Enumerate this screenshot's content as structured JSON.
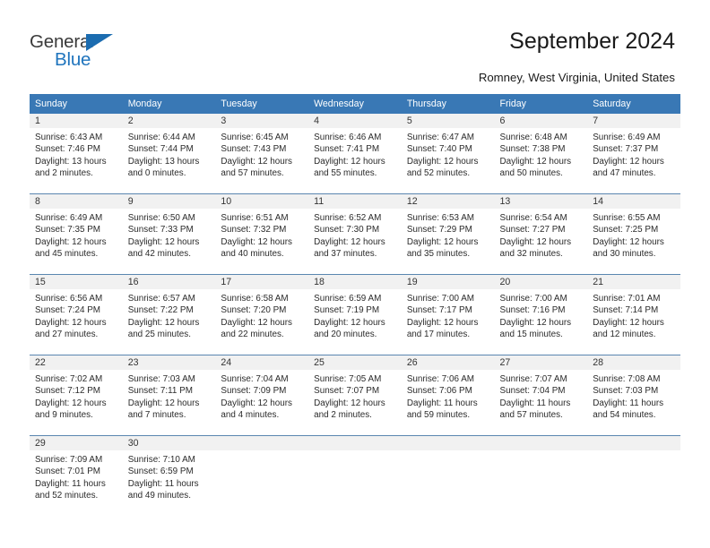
{
  "brand": {
    "name_top": "General",
    "name_bottom": "Blue",
    "accent_color": "#1f74bd",
    "triangle_color": "#1b6cb0"
  },
  "header": {
    "title": "September 2024",
    "subtitle": "Romney, West Virginia, United States"
  },
  "theme": {
    "header_row_bg": "#3978b5",
    "daynum_band_bg": "#f1f1f1",
    "week_separator": "#5a86b0",
    "text": "#2b2b2b"
  },
  "calendar": {
    "weekday_headers": [
      "Sunday",
      "Monday",
      "Tuesday",
      "Wednesday",
      "Thursday",
      "Friday",
      "Saturday"
    ],
    "weeks": [
      [
        {
          "day": "1",
          "sunrise": "Sunrise: 6:43 AM",
          "sunset": "Sunset: 7:46 PM",
          "daylight_1": "Daylight: 13 hours",
          "daylight_2": "and 2 minutes."
        },
        {
          "day": "2",
          "sunrise": "Sunrise: 6:44 AM",
          "sunset": "Sunset: 7:44 PM",
          "daylight_1": "Daylight: 13 hours",
          "daylight_2": "and 0 minutes."
        },
        {
          "day": "3",
          "sunrise": "Sunrise: 6:45 AM",
          "sunset": "Sunset: 7:43 PM",
          "daylight_1": "Daylight: 12 hours",
          "daylight_2": "and 57 minutes."
        },
        {
          "day": "4",
          "sunrise": "Sunrise: 6:46 AM",
          "sunset": "Sunset: 7:41 PM",
          "daylight_1": "Daylight: 12 hours",
          "daylight_2": "and 55 minutes."
        },
        {
          "day": "5",
          "sunrise": "Sunrise: 6:47 AM",
          "sunset": "Sunset: 7:40 PM",
          "daylight_1": "Daylight: 12 hours",
          "daylight_2": "and 52 minutes."
        },
        {
          "day": "6",
          "sunrise": "Sunrise: 6:48 AM",
          "sunset": "Sunset: 7:38 PM",
          "daylight_1": "Daylight: 12 hours",
          "daylight_2": "and 50 minutes."
        },
        {
          "day": "7",
          "sunrise": "Sunrise: 6:49 AM",
          "sunset": "Sunset: 7:37 PM",
          "daylight_1": "Daylight: 12 hours",
          "daylight_2": "and 47 minutes."
        }
      ],
      [
        {
          "day": "8",
          "sunrise": "Sunrise: 6:49 AM",
          "sunset": "Sunset: 7:35 PM",
          "daylight_1": "Daylight: 12 hours",
          "daylight_2": "and 45 minutes."
        },
        {
          "day": "9",
          "sunrise": "Sunrise: 6:50 AM",
          "sunset": "Sunset: 7:33 PM",
          "daylight_1": "Daylight: 12 hours",
          "daylight_2": "and 42 minutes."
        },
        {
          "day": "10",
          "sunrise": "Sunrise: 6:51 AM",
          "sunset": "Sunset: 7:32 PM",
          "daylight_1": "Daylight: 12 hours",
          "daylight_2": "and 40 minutes."
        },
        {
          "day": "11",
          "sunrise": "Sunrise: 6:52 AM",
          "sunset": "Sunset: 7:30 PM",
          "daylight_1": "Daylight: 12 hours",
          "daylight_2": "and 37 minutes."
        },
        {
          "day": "12",
          "sunrise": "Sunrise: 6:53 AM",
          "sunset": "Sunset: 7:29 PM",
          "daylight_1": "Daylight: 12 hours",
          "daylight_2": "and 35 minutes."
        },
        {
          "day": "13",
          "sunrise": "Sunrise: 6:54 AM",
          "sunset": "Sunset: 7:27 PM",
          "daylight_1": "Daylight: 12 hours",
          "daylight_2": "and 32 minutes."
        },
        {
          "day": "14",
          "sunrise": "Sunrise: 6:55 AM",
          "sunset": "Sunset: 7:25 PM",
          "daylight_1": "Daylight: 12 hours",
          "daylight_2": "and 30 minutes."
        }
      ],
      [
        {
          "day": "15",
          "sunrise": "Sunrise: 6:56 AM",
          "sunset": "Sunset: 7:24 PM",
          "daylight_1": "Daylight: 12 hours",
          "daylight_2": "and 27 minutes."
        },
        {
          "day": "16",
          "sunrise": "Sunrise: 6:57 AM",
          "sunset": "Sunset: 7:22 PM",
          "daylight_1": "Daylight: 12 hours",
          "daylight_2": "and 25 minutes."
        },
        {
          "day": "17",
          "sunrise": "Sunrise: 6:58 AM",
          "sunset": "Sunset: 7:20 PM",
          "daylight_1": "Daylight: 12 hours",
          "daylight_2": "and 22 minutes."
        },
        {
          "day": "18",
          "sunrise": "Sunrise: 6:59 AM",
          "sunset": "Sunset: 7:19 PM",
          "daylight_1": "Daylight: 12 hours",
          "daylight_2": "and 20 minutes."
        },
        {
          "day": "19",
          "sunrise": "Sunrise: 7:00 AM",
          "sunset": "Sunset: 7:17 PM",
          "daylight_1": "Daylight: 12 hours",
          "daylight_2": "and 17 minutes."
        },
        {
          "day": "20",
          "sunrise": "Sunrise: 7:00 AM",
          "sunset": "Sunset: 7:16 PM",
          "daylight_1": "Daylight: 12 hours",
          "daylight_2": "and 15 minutes."
        },
        {
          "day": "21",
          "sunrise": "Sunrise: 7:01 AM",
          "sunset": "Sunset: 7:14 PM",
          "daylight_1": "Daylight: 12 hours",
          "daylight_2": "and 12 minutes."
        }
      ],
      [
        {
          "day": "22",
          "sunrise": "Sunrise: 7:02 AM",
          "sunset": "Sunset: 7:12 PM",
          "daylight_1": "Daylight: 12 hours",
          "daylight_2": "and 9 minutes."
        },
        {
          "day": "23",
          "sunrise": "Sunrise: 7:03 AM",
          "sunset": "Sunset: 7:11 PM",
          "daylight_1": "Daylight: 12 hours",
          "daylight_2": "and 7 minutes."
        },
        {
          "day": "24",
          "sunrise": "Sunrise: 7:04 AM",
          "sunset": "Sunset: 7:09 PM",
          "daylight_1": "Daylight: 12 hours",
          "daylight_2": "and 4 minutes."
        },
        {
          "day": "25",
          "sunrise": "Sunrise: 7:05 AM",
          "sunset": "Sunset: 7:07 PM",
          "daylight_1": "Daylight: 12 hours",
          "daylight_2": "and 2 minutes."
        },
        {
          "day": "26",
          "sunrise": "Sunrise: 7:06 AM",
          "sunset": "Sunset: 7:06 PM",
          "daylight_1": "Daylight: 11 hours",
          "daylight_2": "and 59 minutes."
        },
        {
          "day": "27",
          "sunrise": "Sunrise: 7:07 AM",
          "sunset": "Sunset: 7:04 PM",
          "daylight_1": "Daylight: 11 hours",
          "daylight_2": "and 57 minutes."
        },
        {
          "day": "28",
          "sunrise": "Sunrise: 7:08 AM",
          "sunset": "Sunset: 7:03 PM",
          "daylight_1": "Daylight: 11 hours",
          "daylight_2": "and 54 minutes."
        }
      ],
      [
        {
          "day": "29",
          "sunrise": "Sunrise: 7:09 AM",
          "sunset": "Sunset: 7:01 PM",
          "daylight_1": "Daylight: 11 hours",
          "daylight_2": "and 52 minutes."
        },
        {
          "day": "30",
          "sunrise": "Sunrise: 7:10 AM",
          "sunset": "Sunset: 6:59 PM",
          "daylight_1": "Daylight: 11 hours",
          "daylight_2": "and 49 minutes."
        },
        {
          "day": "",
          "sunrise": "",
          "sunset": "",
          "daylight_1": "",
          "daylight_2": ""
        },
        {
          "day": "",
          "sunrise": "",
          "sunset": "",
          "daylight_1": "",
          "daylight_2": ""
        },
        {
          "day": "",
          "sunrise": "",
          "sunset": "",
          "daylight_1": "",
          "daylight_2": ""
        },
        {
          "day": "",
          "sunrise": "",
          "sunset": "",
          "daylight_1": "",
          "daylight_2": ""
        },
        {
          "day": "",
          "sunrise": "",
          "sunset": "",
          "daylight_1": "",
          "daylight_2": ""
        }
      ]
    ]
  }
}
